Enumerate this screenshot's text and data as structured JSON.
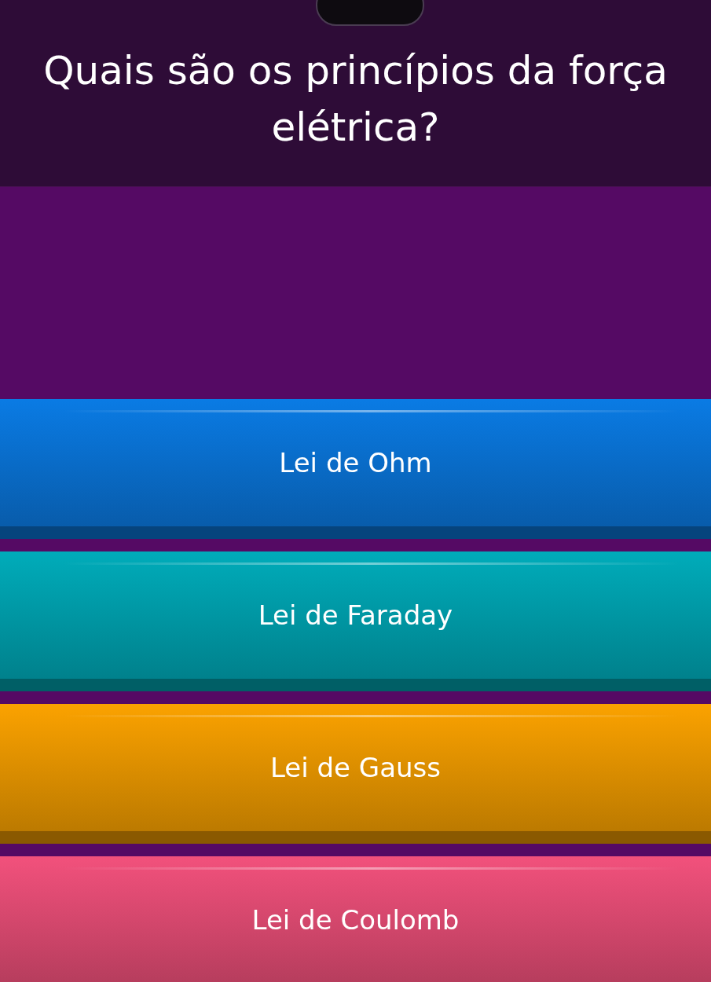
{
  "question": "Quais são os princípios da força elétrica?",
  "answers": [
    {
      "label": "Lei de Ohm",
      "color": "#0a7be4"
    },
    {
      "label": "Lei de Faraday",
      "color": "#00acba"
    },
    {
      "label": "Lei de Gauss",
      "color": "#fba200"
    },
    {
      "label": "Lei de Coulomb",
      "color": "#f2517c"
    }
  ]
}
